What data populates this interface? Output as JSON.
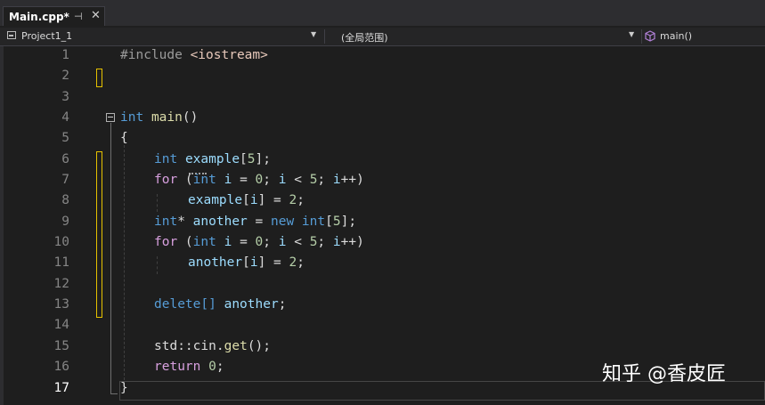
{
  "tab": {
    "filename": "Main.cpp*",
    "pin_glyph": "⊣",
    "close_glyph": "✕"
  },
  "navbar": {
    "project": "Project1_1",
    "scope": "(全局范围)",
    "member": "main()"
  },
  "editor": {
    "line_numbers": [
      "1",
      "2",
      "3",
      "4",
      "5",
      "6",
      "7",
      "8",
      "9",
      "10",
      "11",
      "12",
      "13",
      "14",
      "15",
      "16",
      "17"
    ],
    "current_line": "17"
  },
  "code": {
    "l1": {
      "directive": "#include",
      "header": "<iostream>"
    },
    "l4": {
      "type": "int",
      "name": "main",
      "parens": "()"
    },
    "l5": {
      "brace": "{"
    },
    "l6": {
      "type": "int",
      "var": "example",
      "open": "[",
      "num": "5",
      "close": "];"
    },
    "l7": {
      "kw": "for",
      "p1": " (",
      "type": "int",
      "var1": "i",
      "op1": " = ",
      "n1": "0",
      "sep1": "; ",
      "var2": "i",
      "op2": " < ",
      "n2": "5",
      "sep2": "; ",
      "var3": "i",
      "tail": "++)"
    },
    "l8": {
      "var": "example",
      "open": "[",
      "idx": "i",
      "close": "] = ",
      "num": "2",
      "end": ";"
    },
    "l9": {
      "type": "int",
      "star": "*",
      "var": "another",
      "op": " = ",
      "kw": "new",
      "type2": "int",
      "open": "[",
      "num": "5",
      "close": "];"
    },
    "l10": {
      "kw": "for",
      "p1": " (",
      "type": "int",
      "var1": "i",
      "op1": " = ",
      "n1": "0",
      "sep1": "; ",
      "var2": "i",
      "op2": " < ",
      "n2": "5",
      "sep2": "; ",
      "var3": "i",
      "tail": "++)"
    },
    "l11": {
      "var": "another",
      "open": "[",
      "idx": "i",
      "close": "] = ",
      "num": "2",
      "end": ";"
    },
    "l13": {
      "kw": "delete",
      "brackets": "[]",
      "var": "another",
      "end": ";"
    },
    "l15": {
      "ns": "std",
      "colons": "::",
      "obj": "cin",
      "dot": ".",
      "fn": "get",
      "end": "();"
    },
    "l16": {
      "kw": "return",
      "num": "0",
      "end": ";"
    },
    "l17": {
      "brace": "}"
    }
  },
  "watermark": "知乎 @香皮匠",
  "colors": {
    "keyword": "#569cd6",
    "control": "#d8a0df",
    "function": "#dcdcaa",
    "variable": "#9cdcfe",
    "number": "#b5cea8",
    "change_marker": "#e6c200"
  }
}
